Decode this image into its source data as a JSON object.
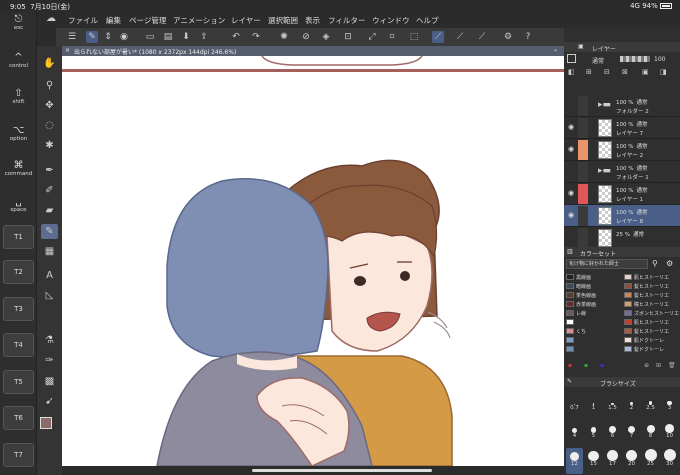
{
  "status": {
    "time": "9:05",
    "date": "7月10日(金)",
    "network": "4G",
    "battery": "94%"
  },
  "menu": [
    "ファイル",
    "編集",
    "ページ管理",
    "アニメーション",
    "レイヤー",
    "選択範囲",
    "表示",
    "フィルター",
    "ウィンドウ",
    "ヘルプ"
  ],
  "keys": [
    {
      "glyph": "⎋",
      "label": "esc"
    },
    {
      "glyph": "^",
      "label": "control"
    },
    {
      "glyph": "⇧",
      "label": "shift"
    },
    {
      "glyph": "⌥",
      "label": "option"
    },
    {
      "glyph": "⌘",
      "label": "command"
    },
    {
      "glyph": "␣",
      "label": "space"
    },
    {
      "label": "T1"
    },
    {
      "label": "T2"
    },
    {
      "label": "T3"
    },
    {
      "label": "T4"
    },
    {
      "label": "T5"
    },
    {
      "label": "T6"
    },
    {
      "label": "T7"
    }
  ],
  "canvas_tab": "出られない部屋が暑い* (1080 x 2372px 144dpi 246.6%)",
  "layer_panel": {
    "title": "レイヤー",
    "blend_mode": "通常",
    "opacity": "100",
    "layers": [
      {
        "opacity": "100 %",
        "mode": "通常",
        "name": "フォルダー 2",
        "type": "folder",
        "tag": "#3a3a3a",
        "visible": false
      },
      {
        "opacity": "100 %",
        "mode": "通常",
        "name": "レイヤー 7",
        "type": "layer",
        "tag": "#3a3a3a",
        "visible": true
      },
      {
        "opacity": "100 %",
        "mode": "通常",
        "name": "レイヤー 2",
        "type": "layer",
        "tag": "#e8956a",
        "visible": true
      },
      {
        "opacity": "100 %",
        "mode": "通常",
        "name": "フォルダー 1",
        "type": "folder",
        "tag": "#3a3a3a",
        "visible": false
      },
      {
        "opacity": "100 %",
        "mode": "通常",
        "name": "レイヤー 1",
        "type": "layer",
        "tag": "#e05757",
        "visible": true
      },
      {
        "opacity": "100 %",
        "mode": "通常",
        "name": "レイヤー 8",
        "type": "layer",
        "tag": "#3a3a3a",
        "visible": true,
        "selected": true
      },
      {
        "opacity": "25 %",
        "mode": "通常",
        "name": "",
        "type": "layer",
        "tag": "#3a3a3a",
        "visible": false
      }
    ]
  },
  "color_set": {
    "title": "カラーセット",
    "set_name": "化け物に好かれた師士",
    "colors": [
      {
        "c1": "#222222",
        "n1": "黒線画",
        "c2": "#e8d0c8",
        "n2": "肌ヒストーリエ"
      },
      {
        "c1": "#3c4a5c",
        "n1": "暗線画",
        "c2": "#8a5040",
        "n2": "髪ヒストーリエ"
      },
      {
        "c1": "#5a3a2a",
        "n1": "茶色線画",
        "c2": "#c8845a",
        "n2": "髪ヒストーリエ"
      },
      {
        "c1": "#6a2a2a",
        "n1": "赤茶線画",
        "c2": "#d0a070",
        "n2": "瞳ヒストーリエ"
      },
      {
        "c1": "#6a5a5a",
        "n1": "レ線",
        "c2": "#7a6a9a",
        "n2": "ズボンヒストーリエ"
      },
      {
        "c1": "#ffffff",
        "n1": "",
        "c2": "#c83a2a",
        "n2": "肌ヒストーリエ"
      },
      {
        "c1": "#d89090",
        "n1": "くち",
        "c2": "#b05a3a",
        "n2": "髪ヒストーリエ"
      },
      {
        "c1": "#7aa0c8",
        "n1": "",
        "c2": "#f0e0d8",
        "n2": "肌ドクトーレ"
      },
      {
        "c1": "#6a90c0",
        "n1": "",
        "c2": "#a8b8d8",
        "n2": "髪ドクトーレ"
      }
    ]
  },
  "brush_panel": {
    "title": "ブラシサイズ",
    "sizes": [
      "0.7",
      "1",
      "1.5",
      "2",
      "2.5",
      "3",
      "4",
      "5",
      "6",
      "7",
      "8",
      "10",
      "12",
      "15",
      "17",
      "20",
      "25",
      "30"
    ],
    "selected": "12"
  },
  "colors": {
    "accent": "#4a5f88",
    "hair_blue": "#7e8fb3",
    "hair_brown": "#8b5a3c",
    "skin": "#fbe7dc",
    "shirt_orange": "#d59a45",
    "shirt_gray": "#8e8b9e",
    "fg_color": "#8b6a6a",
    "bg_color": "#3aa63a"
  }
}
